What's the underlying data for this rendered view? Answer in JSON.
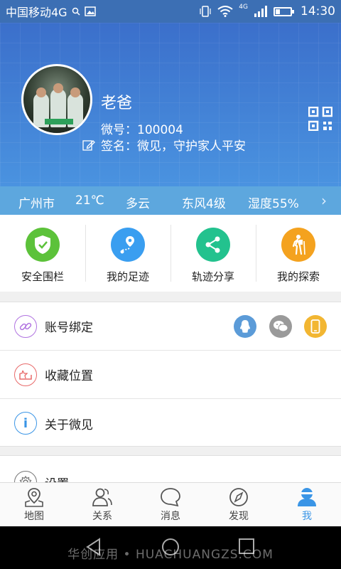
{
  "status_bar": {
    "carrier": "中国移动4G",
    "network_small": "4G",
    "time": "14:30",
    "icons": [
      "search-icon",
      "image-icon",
      "vibrate-icon",
      "wifi-icon",
      "signal-icon",
      "battery-icon"
    ]
  },
  "profile": {
    "name": "老爸",
    "id_line": "微号：100004",
    "signature_line": "签名：微见，守护家人平安"
  },
  "weather": {
    "city": "广州市",
    "temperature": "21℃",
    "condition": "多云",
    "wind": "东风4级",
    "humidity": "湿度55%"
  },
  "features": [
    {
      "label": "安全围栏",
      "icon": "shield-check-icon",
      "color": "#5cc23a"
    },
    {
      "label": "我的足迹",
      "icon": "footprint-route-icon",
      "color": "#3a9ef0"
    },
    {
      "label": "轨迹分享",
      "icon": "share-icon",
      "color": "#23c28e"
    },
    {
      "label": "我的探索",
      "icon": "hiker-icon",
      "color": "#f4a21f"
    }
  ],
  "menu": [
    {
      "label": "账号绑定",
      "icon": "link-icon",
      "color": "#b072e0"
    },
    {
      "label": "收藏位置",
      "icon": "bookmark-location-icon",
      "color": "#e86a6a"
    },
    {
      "label": "关于微见",
      "icon": "info-icon",
      "color": "#3a95e6"
    }
  ],
  "bindings": [
    {
      "name": "qq-icon",
      "color": "#5b9bd8"
    },
    {
      "name": "wechat-icon",
      "color": "#9a9a9a"
    },
    {
      "name": "phone-icon",
      "color": "#f2b632"
    }
  ],
  "settings": {
    "label": "设置",
    "icon": "gear-icon"
  },
  "tabs": [
    {
      "label": "地图",
      "icon": "map-pin-icon",
      "active": false
    },
    {
      "label": "关系",
      "icon": "people-icon",
      "active": false
    },
    {
      "label": "消息",
      "icon": "chat-bubble-icon",
      "active": false
    },
    {
      "label": "发现",
      "icon": "compass-icon",
      "active": false
    },
    {
      "label": "我",
      "icon": "me-icon",
      "active": true
    }
  ],
  "watermark": "华创应用 • HUACHUANGZS.COM"
}
